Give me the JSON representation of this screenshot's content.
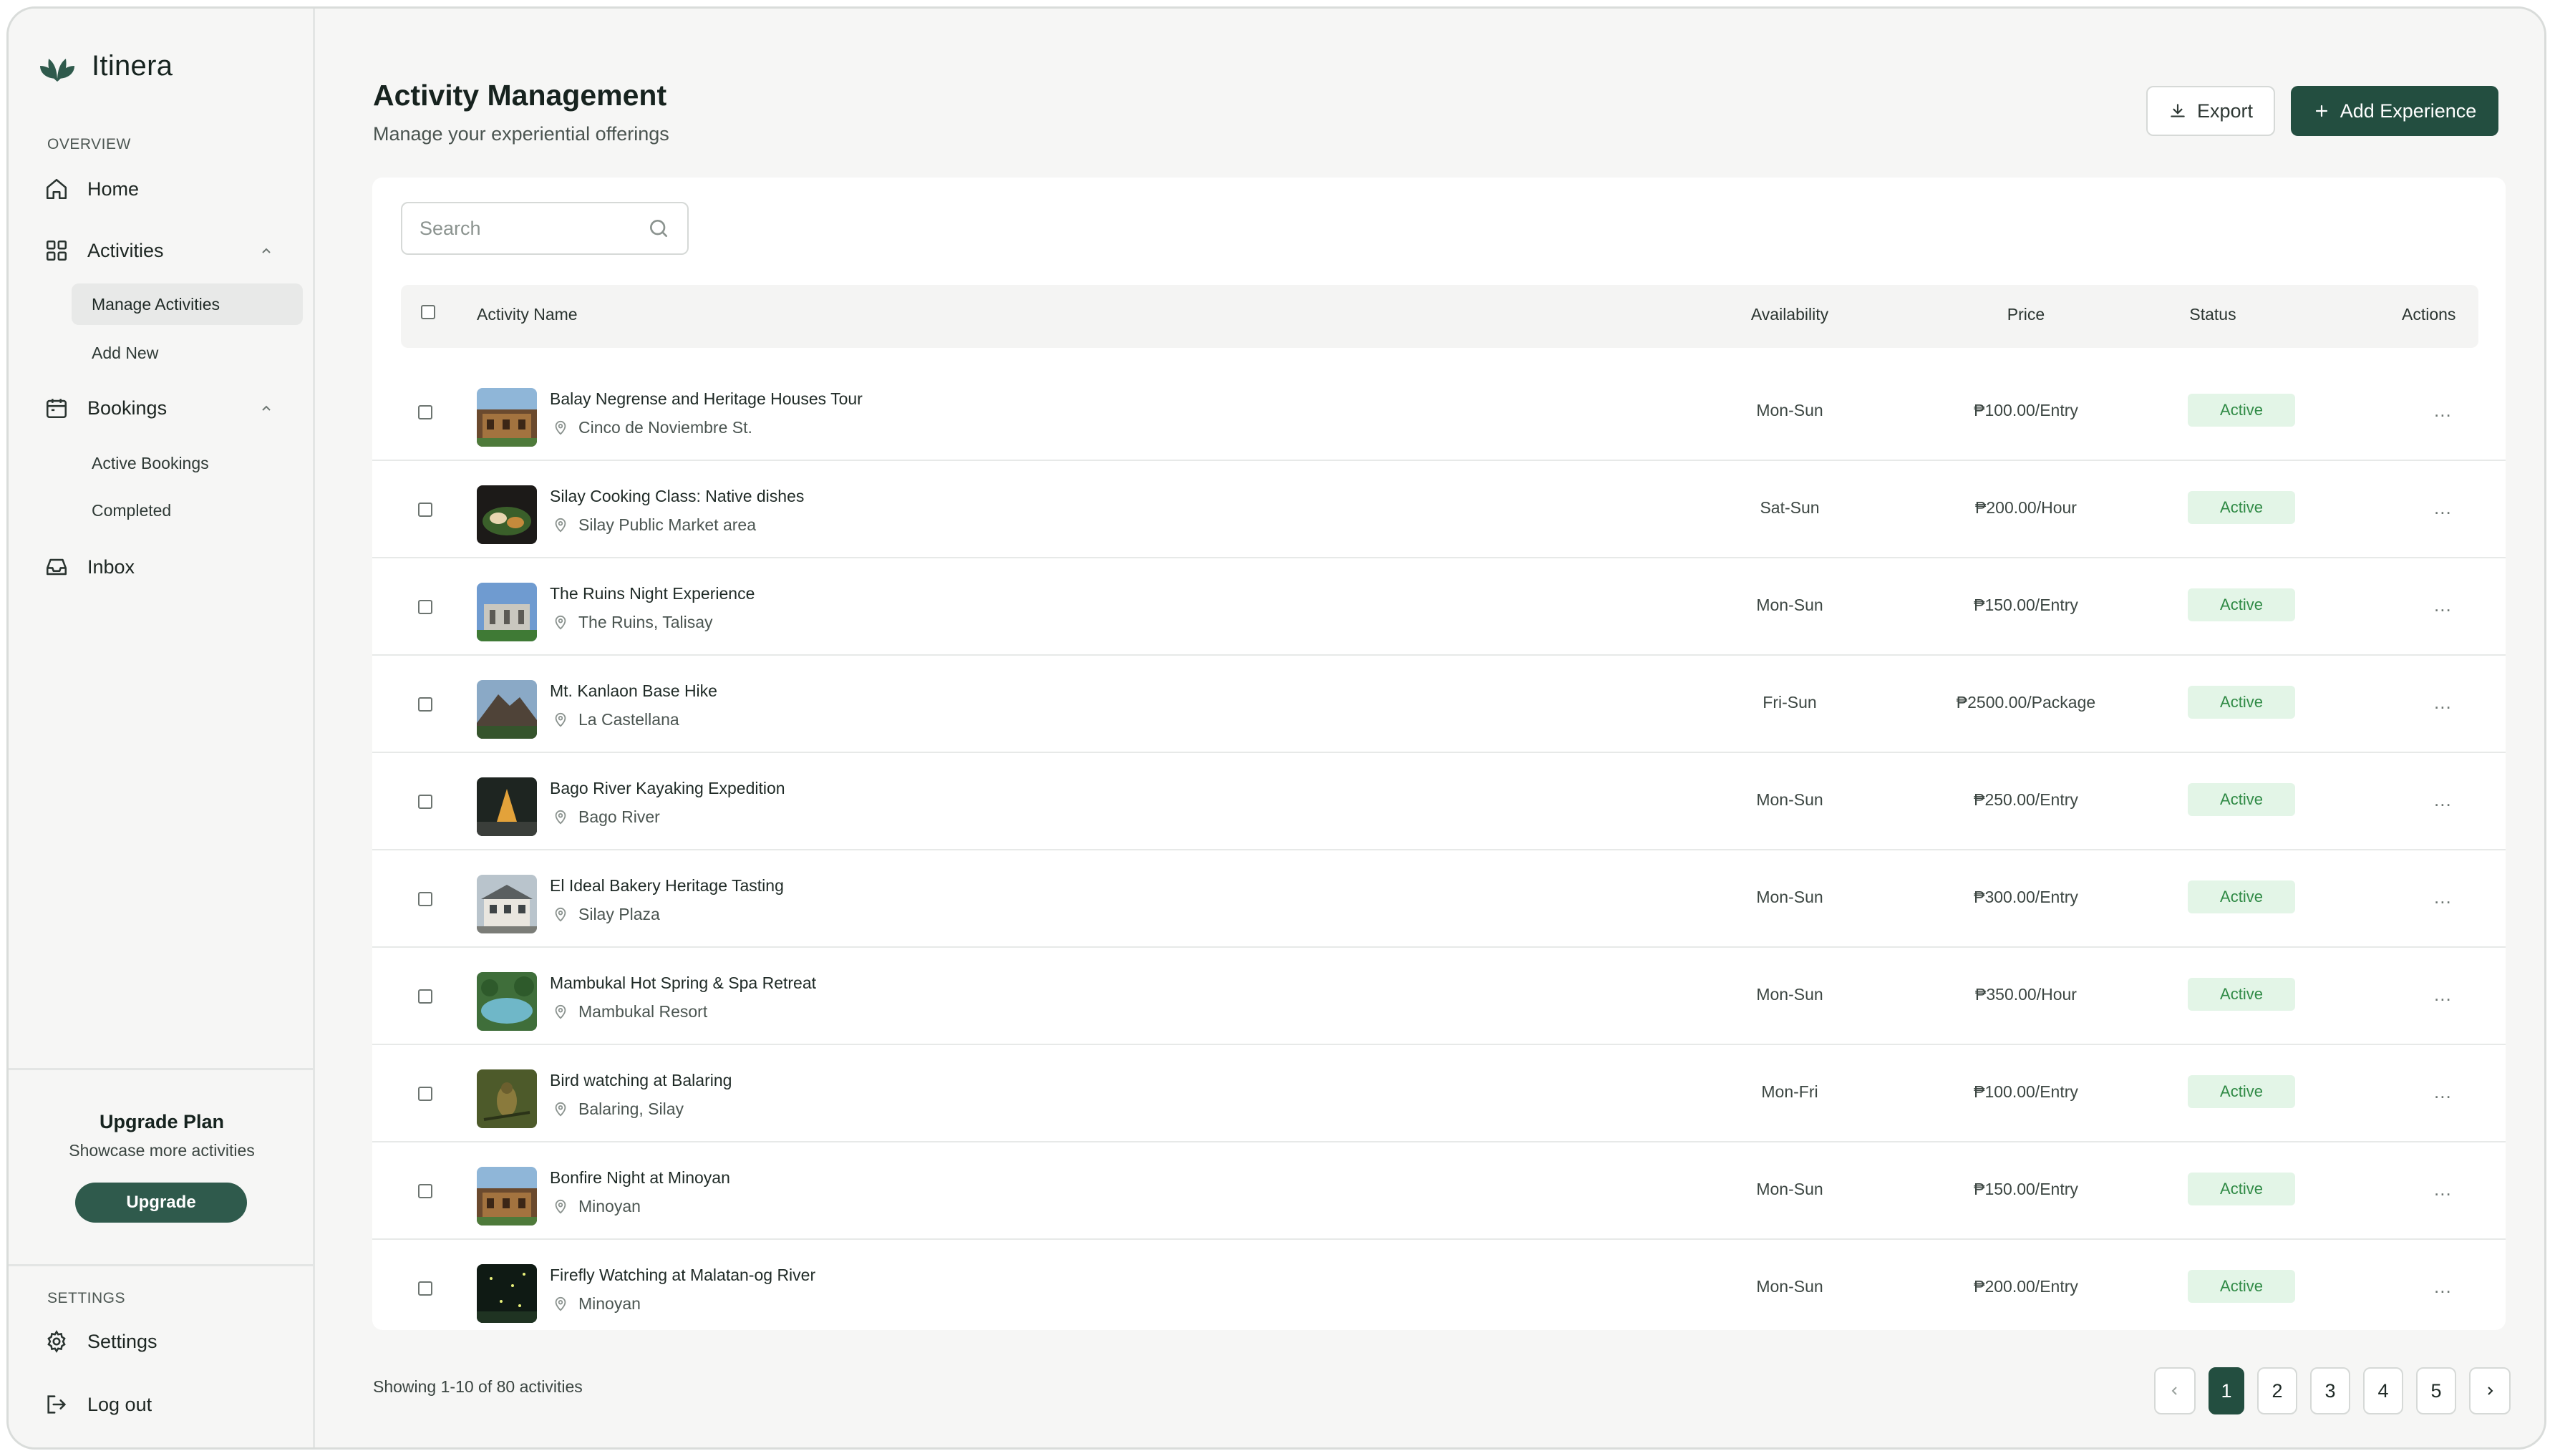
{
  "brand": {
    "name": "Itinera"
  },
  "sidebar": {
    "overview_label": "OVERVIEW",
    "home": "Home",
    "activities": "Activities",
    "activities_sub": [
      "Manage Activities",
      "Add New"
    ],
    "bookings": "Bookings",
    "bookings_sub": [
      "Active Bookings",
      "Completed"
    ],
    "inbox": "Inbox",
    "upgrade": {
      "title": "Upgrade Plan",
      "subtitle": "Showcase more activities",
      "button": "Upgrade"
    },
    "settings_label": "SETTINGS",
    "settings": "Settings",
    "logout": "Log out"
  },
  "header": {
    "title": "Activity Management",
    "subtitle": "Manage your experiential offerings",
    "export_label": "Export",
    "add_label": "Add Experience"
  },
  "search": {
    "placeholder": "Search"
  },
  "table": {
    "columns": {
      "name": "Activity Name",
      "availability": "Availability",
      "price": "Price",
      "status": "Status",
      "actions": "Actions"
    },
    "rows": [
      {
        "name": "Balay Negrense and Heritage Houses Tour",
        "location": "Cinco de Noviembre St.",
        "availability": "Mon-Sun",
        "price": "₱100.00/Entry",
        "status": "Active",
        "actions": "..."
      },
      {
        "name": "Silay Cooking Class: Native dishes",
        "location": "Silay Public Market area",
        "availability": "Sat-Sun",
        "price": "₱200.00/Hour",
        "status": "Active",
        "actions": "..."
      },
      {
        "name": "The Ruins Night Experience",
        "location": "The Ruins, Talisay",
        "availability": "Mon-Sun",
        "price": "₱150.00/Entry",
        "status": "Active",
        "actions": "..."
      },
      {
        "name": "Mt. Kanlaon Base Hike",
        "location": "La Castellana",
        "availability": "Fri-Sun",
        "price": "₱2500.00/Package",
        "status": "Active",
        "actions": "..."
      },
      {
        "name": "Bago River Kayaking Expedition",
        "location": "Bago River",
        "availability": "Mon-Sun",
        "price": "₱250.00/Entry",
        "status": "Active",
        "actions": "..."
      },
      {
        "name": "El Ideal Bakery Heritage Tasting",
        "location": "Silay Plaza",
        "availability": "Mon-Sun",
        "price": "₱300.00/Entry",
        "status": "Active",
        "actions": "..."
      },
      {
        "name": "Mambukal Hot Spring & Spa Retreat",
        "location": "Mambukal Resort",
        "availability": "Mon-Sun",
        "price": "₱350.00/Hour",
        "status": "Active",
        "actions": "..."
      },
      {
        "name": "Bird watching at Balaring",
        "location": "Balaring, Silay",
        "availability": "Mon-Fri",
        "price": "₱100.00/Entry",
        "status": "Active",
        "actions": "..."
      },
      {
        "name": "Bonfire Night at Minoyan",
        "location": "Minoyan",
        "availability": "Mon-Sun",
        "price": "₱150.00/Entry",
        "status": "Active",
        "actions": "..."
      },
      {
        "name": "Firefly Watching at Malatan-og River",
        "location": "Minoyan",
        "availability": "Mon-Sun",
        "price": "₱200.00/Entry",
        "status": "Active",
        "actions": "..."
      }
    ]
  },
  "footer": {
    "showing": "Showing 1-10 of 80 activities",
    "pages": [
      "1",
      "2",
      "3",
      "4",
      "5"
    ],
    "current_page": "1"
  },
  "colors": {
    "accent": "#234e40",
    "status_bg": "#e3f5e7",
    "status_text": "#2f8a45"
  }
}
